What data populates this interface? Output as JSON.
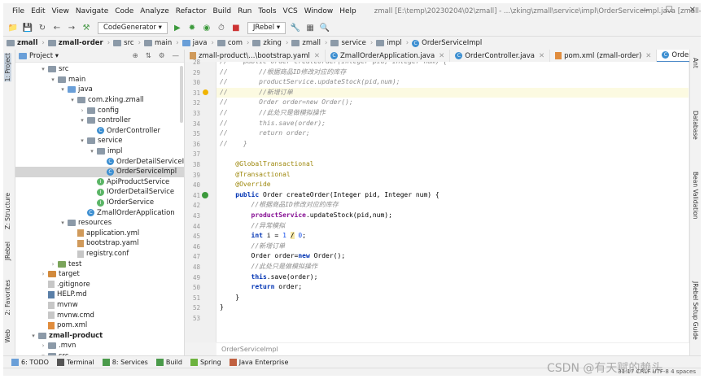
{
  "window": {
    "menu": [
      "File",
      "Edit",
      "View",
      "Navigate",
      "Code",
      "Analyze",
      "Refactor",
      "Build",
      "Run",
      "Tools",
      "VCS",
      "Window",
      "Help"
    ],
    "title": "zmall [E:\\temp\\20230204\\02\\zmall] - ...\\zking\\zmall\\service\\impl\\OrderServiceImpl.java [zmall-order]",
    "controls": [
      "—",
      "☐",
      "✕"
    ]
  },
  "toolbar": {
    "run_config": "CodeGenerator ▾",
    "jrebel": "JRebel ▾"
  },
  "breadcrumb": [
    "zmall",
    "zmall-order",
    "src",
    "main",
    "java",
    "com",
    "zking",
    "zmall",
    "service",
    "impl",
    "OrderServiceImpl"
  ],
  "project": {
    "title": "Project ▾",
    "tree": [
      {
        "label": "src",
        "arrow": "▾",
        "indent": 3,
        "icon": "folder"
      },
      {
        "label": "main",
        "arrow": "▾",
        "indent": 4,
        "icon": "folder"
      },
      {
        "label": "java",
        "arrow": "▾",
        "indent": 5,
        "icon": "folder-blue"
      },
      {
        "label": "com.zking.zmall",
        "arrow": "▾",
        "indent": 6,
        "icon": "folder"
      },
      {
        "label": "config",
        "arrow": "›",
        "indent": 7,
        "icon": "folder"
      },
      {
        "label": "controller",
        "arrow": "▾",
        "indent": 7,
        "icon": "folder"
      },
      {
        "label": "OrderController",
        "arrow": "",
        "indent": 8,
        "icon": "class"
      },
      {
        "label": "service",
        "arrow": "▾",
        "indent": 7,
        "icon": "folder"
      },
      {
        "label": "impl",
        "arrow": "▾",
        "indent": 8,
        "icon": "folder"
      },
      {
        "label": "OrderDetailServiceImpl",
        "arrow": "",
        "indent": 9,
        "icon": "class"
      },
      {
        "label": "OrderServiceImpl",
        "arrow": "",
        "indent": 9,
        "icon": "class",
        "selected": true
      },
      {
        "label": "ApiProductService",
        "arrow": "",
        "indent": 8,
        "icon": "iface"
      },
      {
        "label": "IOrderDetailService",
        "arrow": "",
        "indent": 8,
        "icon": "iface"
      },
      {
        "label": "IOrderService",
        "arrow": "",
        "indent": 8,
        "icon": "iface"
      },
      {
        "label": "ZmallOrderApplication",
        "arrow": "",
        "indent": 7,
        "icon": "class"
      },
      {
        "label": "resources",
        "arrow": "▾",
        "indent": 5,
        "icon": "folder"
      },
      {
        "label": "application.yml",
        "arrow": "",
        "indent": 6,
        "icon": "yml"
      },
      {
        "label": "bootstrap.yaml",
        "arrow": "",
        "indent": 6,
        "icon": "yml"
      },
      {
        "label": "registry.conf",
        "arrow": "",
        "indent": 6,
        "icon": "file"
      },
      {
        "label": "test",
        "arrow": "›",
        "indent": 4,
        "icon": "folder-green"
      },
      {
        "label": "target",
        "arrow": "›",
        "indent": 3,
        "icon": "folder-orange"
      },
      {
        "label": ".gitignore",
        "arrow": "",
        "indent": 3,
        "icon": "file"
      },
      {
        "label": "HELP.md",
        "arrow": "",
        "indent": 3,
        "icon": "md"
      },
      {
        "label": "mvnw",
        "arrow": "",
        "indent": 3,
        "icon": "file"
      },
      {
        "label": "mvnw.cmd",
        "arrow": "",
        "indent": 3,
        "icon": "file"
      },
      {
        "label": "pom.xml",
        "arrow": "",
        "indent": 3,
        "icon": "xml"
      },
      {
        "label": "zmall-product",
        "arrow": "▾",
        "indent": 2,
        "icon": "folder",
        "bold": true
      },
      {
        "label": ".mvn",
        "arrow": "›",
        "indent": 3,
        "icon": "folder"
      },
      {
        "label": "src",
        "arrow": "▾",
        "indent": 3,
        "icon": "folder"
      }
    ]
  },
  "left_tool_tabs": [
    "1: Project",
    "Z: Structure",
    "JRebel",
    "2: Favorites",
    "Web"
  ],
  "right_tool_tabs": [
    "Ant",
    "Database",
    "Bean Validation",
    "JRebel Setup Guide"
  ],
  "editor_tabs": [
    {
      "label": "zmall-product\\...\\bootstrap.yaml",
      "active": false
    },
    {
      "label": "ZmallOrderApplication.java",
      "active": false
    },
    {
      "label": "OrderController.java",
      "active": false
    },
    {
      "label": "pom.xml (zmall-order)",
      "active": false
    },
    {
      "label": "OrderServiceImpl.java",
      "active": true
    }
  ],
  "code_lines": [
    {
      "n": "28",
      "t": "//    public Order createOrder(Integer pid, Integer num) {",
      "style": "cmt"
    },
    {
      "n": "29",
      "t": "//        //根据商品ID修改对应的库存",
      "style": "cmt"
    },
    {
      "n": "30",
      "t": "//        productService.updateStock(pid,num);",
      "style": "cmt"
    },
    {
      "n": "31",
      "t": "//        //新增订单",
      "style": "cmt",
      "hl": true
    },
    {
      "n": "32",
      "t": "//        Order order=new Order();",
      "style": "cmt"
    },
    {
      "n": "33",
      "t": "//        //此处只是做模拟操作",
      "style": "cmt"
    },
    {
      "n": "34",
      "t": "//        this.save(order);",
      "style": "cmt"
    },
    {
      "n": "35",
      "t": "//        return order;",
      "style": "cmt"
    },
    {
      "n": "36",
      "t": "//    }",
      "style": "cmt"
    },
    {
      "n": "37",
      "t": "",
      "style": ""
    },
    {
      "n": "38",
      "t": "    @GlobalTransactional",
      "style": "ann"
    },
    {
      "n": "39",
      "t": "    @Transactional",
      "style": "ann"
    },
    {
      "n": "40",
      "t": "    @Override",
      "style": "ann"
    },
    {
      "n": "41",
      "t": "    public Order createOrder(Integer pid, Integer num) {",
      "style": "sig"
    },
    {
      "n": "42",
      "t": "        //根据商品ID修改对应的库存",
      "style": "cmt"
    },
    {
      "n": "43",
      "t": "        productService.updateStock(pid,num);",
      "style": "fld"
    },
    {
      "n": "44",
      "t": "        //异常模拟",
      "style": "cmt"
    },
    {
      "n": "45",
      "t": "        int i = 1 / 0;",
      "style": "int"
    },
    {
      "n": "46",
      "t": "        //新增订单",
      "style": "cmt"
    },
    {
      "n": "47",
      "t": "        Order order=new Order();",
      "style": "new"
    },
    {
      "n": "48",
      "t": "        //此处只是做模拟操作",
      "style": "cmt"
    },
    {
      "n": "49",
      "t": "        this.save(order);",
      "style": "this"
    },
    {
      "n": "50",
      "t": "        return order;",
      "style": "ret"
    },
    {
      "n": "51",
      "t": "    }",
      "style": ""
    },
    {
      "n": "52",
      "t": "}",
      "style": ""
    },
    {
      "n": "53",
      "t": "",
      "style": ""
    }
  ],
  "editor_breadcrumb": "OrderServiceImpl",
  "bottom_tabs": [
    "6: TODO",
    "Terminal",
    "8: Services",
    "Build",
    "Spring",
    "Java Enterprise"
  ],
  "status": {
    "position": "31:17",
    "line_sep": "CRLF",
    "encoding": "UTF-8",
    "indent": "4 spaces"
  },
  "watermark": "CSDN @有天赋的赖头",
  "colors": {
    "accent": "#4a88c7",
    "selection": "#d5d5d5",
    "comment": "#8c8c8c",
    "keyword": "#0033b3",
    "annotation": "#9e880d"
  }
}
